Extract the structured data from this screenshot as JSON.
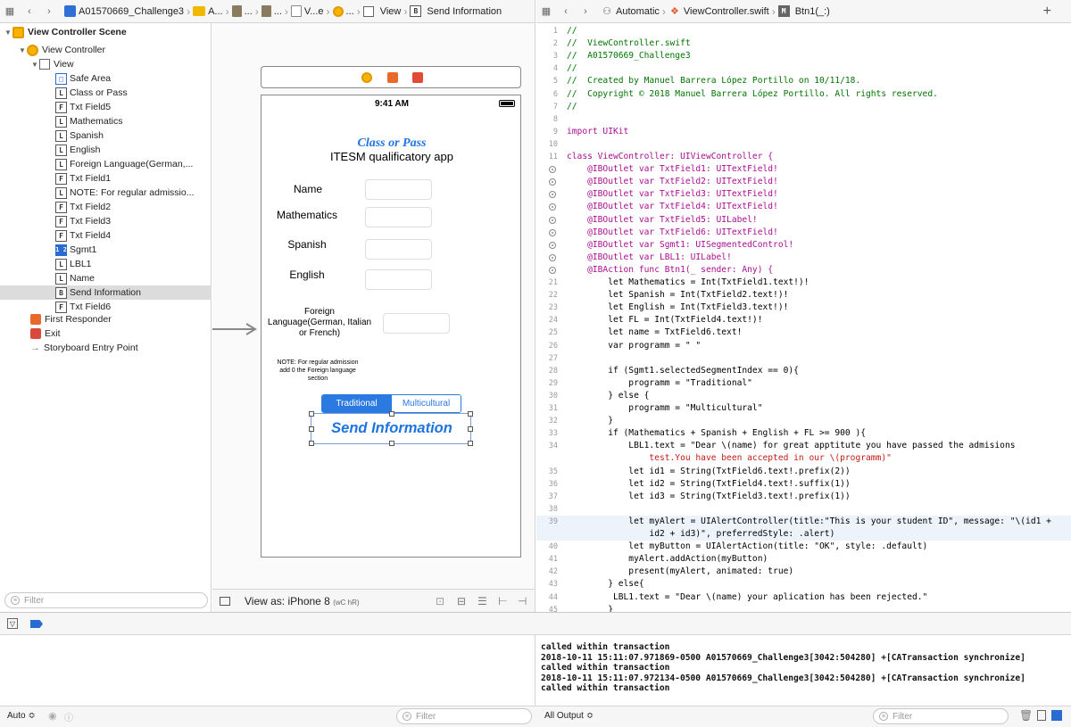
{
  "left_jumpbar": {
    "project": "A01570669_Challenge3",
    "crumbs": [
      "A...",
      "...",
      "...",
      "V...e",
      "...",
      "View",
      "Send Information"
    ]
  },
  "right_jumpbar": {
    "mode": "Automatic",
    "file": "ViewController.swift",
    "symbol_badge": "M",
    "symbol": "Btn1(_:)",
    "plus": "+"
  },
  "outline": {
    "scene": "View Controller Scene",
    "controller": "View Controller",
    "view": "View",
    "items": [
      {
        "badge": "□",
        "label": "Safe Area"
      },
      {
        "badge": "L",
        "label": "Class or Pass"
      },
      {
        "badge": "F",
        "label": "Txt Field5"
      },
      {
        "badge": "L",
        "label": "Mathematics"
      },
      {
        "badge": "L",
        "label": "Spanish"
      },
      {
        "badge": "L",
        "label": "English"
      },
      {
        "badge": "L",
        "label": "Foreign Language(German,..."
      },
      {
        "badge": "F",
        "label": "Txt Field1"
      },
      {
        "badge": "L",
        "label": "NOTE: For regular admissio..."
      },
      {
        "badge": "F",
        "label": "Txt Field2"
      },
      {
        "badge": "F",
        "label": "Txt Field3"
      },
      {
        "badge": "F",
        "label": "Txt Field4"
      },
      {
        "badge": "1 2",
        "label": "Sgmt1"
      },
      {
        "badge": "L",
        "label": "LBL1"
      },
      {
        "badge": "L",
        "label": "Name"
      },
      {
        "badge": "B",
        "label": "Send Information"
      },
      {
        "badge": "F",
        "label": "Txt Field6"
      }
    ],
    "first_responder": "First Responder",
    "exit": "Exit",
    "entry_point": "Storyboard Entry Point",
    "filter_placeholder": "Filter"
  },
  "phone": {
    "time": "9:41 AM",
    "title": "Class or Pass",
    "subtitle": "ITESM qualificatory app",
    "labels": {
      "name": "Name",
      "math": "Mathematics",
      "spanish": "Spanish",
      "english": "English",
      "foreign1": "Foreign",
      "foreign2": "Language(German, Italian",
      "foreign3": "or French)",
      "note1": "NOTE: For regular admission",
      "note2": "add 0 the Foreign language",
      "note3": "section"
    },
    "segments": [
      "Traditional",
      "Multicultural"
    ],
    "button": "Send Information"
  },
  "canvas_bar": {
    "view_as": "View as: iPhone 8",
    "size_class": "(wC hR)"
  },
  "code_lines": [
    {
      "n": "1",
      "t": "//",
      "c": "cm"
    },
    {
      "n": "2",
      "t": "//  ViewController.swift",
      "c": "cm"
    },
    {
      "n": "3",
      "t": "//  A01570669_Challenge3",
      "c": "cm"
    },
    {
      "n": "4",
      "t": "//",
      "c": "cm"
    },
    {
      "n": "5",
      "t": "//  Created by Manuel Barrera López Portillo on 10/11/18.",
      "c": "cm"
    },
    {
      "n": "6",
      "t": "//  Copyright © 2018 Manuel Barrera López Portillo. All rights reserved.",
      "c": "cm"
    },
    {
      "n": "7",
      "t": "//",
      "c": "cm"
    },
    {
      "n": "8",
      "t": "",
      "c": "b"
    },
    {
      "n": "9",
      "t": "import UIKit",
      "c": "kw"
    },
    {
      "n": "10",
      "t": "",
      "c": "b"
    },
    {
      "n": "11",
      "t": "class ViewController: UIViewController {",
      "c": "kw"
    },
    {
      "n": "",
      "t": "    @IBOutlet var TxtField1: UITextField!",
      "c": "kw",
      "g": true
    },
    {
      "n": "",
      "t": "    @IBOutlet var TxtField2: UITextField!",
      "c": "kw",
      "g": true
    },
    {
      "n": "",
      "t": "    @IBOutlet var TxtField3: UITextField!",
      "c": "kw",
      "g": true
    },
    {
      "n": "",
      "t": "    @IBOutlet var TxtField4: UITextField!",
      "c": "kw",
      "g": true
    },
    {
      "n": "",
      "t": "    @IBOutlet var TxtField5: UILabel!",
      "c": "kw",
      "g": true
    },
    {
      "n": "",
      "t": "    @IBOutlet var TxtField6: UITextField!",
      "c": "kw",
      "g": true
    },
    {
      "n": "",
      "t": "    @IBOutlet var Sgmt1: UISegmentedControl!",
      "c": "kw",
      "g": true
    },
    {
      "n": "",
      "t": "    @IBOutlet var LBL1: UILabel!",
      "c": "kw",
      "g": true
    },
    {
      "n": "",
      "t": "    @IBAction func Btn1(_ sender: Any) {",
      "c": "kw",
      "g": true
    },
    {
      "n": "21",
      "t": "        let Mathematics = Int(TxtField1.text!)!",
      "c": "b"
    },
    {
      "n": "22",
      "t": "        let Spanish = Int(TxtField2.text!)!",
      "c": "b"
    },
    {
      "n": "23",
      "t": "        let English = Int(TxtField3.text!)!",
      "c": "b"
    },
    {
      "n": "24",
      "t": "        let FL = Int(TxtField4.text!)!",
      "c": "b"
    },
    {
      "n": "25",
      "t": "        let name = TxtField6.text!",
      "c": "b"
    },
    {
      "n": "26",
      "t": "        var programm = \" \"",
      "c": "b"
    },
    {
      "n": "27",
      "t": "",
      "c": "b"
    },
    {
      "n": "28",
      "t": "        if (Sgmt1.selectedSegmentIndex == 0){",
      "c": "b"
    },
    {
      "n": "29",
      "t": "            programm = \"Traditional\"",
      "c": "b"
    },
    {
      "n": "30",
      "t": "        } else {",
      "c": "b"
    },
    {
      "n": "31",
      "t": "            programm = \"Multicultural\"",
      "c": "b"
    },
    {
      "n": "32",
      "t": "        }",
      "c": "b"
    },
    {
      "n": "33",
      "t": "        if (Mathematics + Spanish + English + FL >= 900 ){",
      "c": "b"
    },
    {
      "n": "34",
      "t": "            LBL1.text = \"Dear \\(name) for great apptitute you have passed the admisions",
      "c": "b"
    },
    {
      "n": "",
      "t": "                test.You have been accepted in our \\(programm)\"",
      "c": "str"
    },
    {
      "n": "35",
      "t": "            let id1 = String(TxtField6.text!.prefix(2))",
      "c": "b"
    },
    {
      "n": "36",
      "t": "            let id2 = String(TxtField4.text!.suffix(1))",
      "c": "b"
    },
    {
      "n": "37",
      "t": "            let id3 = String(TxtField3.text!.prefix(1))",
      "c": "b"
    },
    {
      "n": "38",
      "t": "",
      "c": "b"
    },
    {
      "n": "39",
      "t": "            let myAlert = UIAlertController(title:\"This is your student ID\", message: \"\\(id1 +",
      "c": "b",
      "cur": true
    },
    {
      "n": "",
      "t": "                id2 + id3)\", preferredStyle: .alert)",
      "c": "b",
      "cur": true
    },
    {
      "n": "40",
      "t": "            let myButton = UIAlertAction(title: \"OK\", style: .default)",
      "c": "b"
    },
    {
      "n": "41",
      "t": "            myAlert.addAction(myButton)",
      "c": "b"
    },
    {
      "n": "42",
      "t": "            present(myAlert, animated: true)",
      "c": "b"
    },
    {
      "n": "43",
      "t": "        } else{",
      "c": "b"
    },
    {
      "n": "44",
      "t": "         LBL1.text = \"Dear \\(name) your aplication has been rejected.\"",
      "c": "b"
    },
    {
      "n": "45",
      "t": "        }",
      "c": "b"
    }
  ],
  "console_lines": [
    "called within transaction",
    "2018-10-11 15:11:07.971869-0500 A01570669_Challenge3[3042:504280] +[CATransaction synchronize]",
    "called within transaction",
    "2018-10-11 15:11:07.972134-0500 A01570669_Challenge3[3042:504280] +[CATransaction synchronize]",
    "called within transaction"
  ],
  "bottom": {
    "auto": "Auto ≎",
    "filter_placeholder": "Filter",
    "all_output": "All Output ≎"
  },
  "colors": {
    "accent": "#2a7ae2",
    "title_blue": "#1f74e0"
  }
}
